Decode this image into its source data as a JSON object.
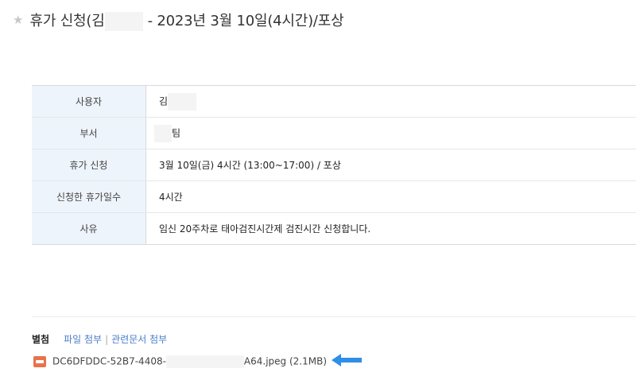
{
  "header": {
    "title_before": "휴가 신청(김",
    "title_after": "- 2023년 3월 10일(4시간)/포상"
  },
  "details": {
    "rows": [
      {
        "label": "사용자",
        "value": "김"
      },
      {
        "label": "부서",
        "value": "팀"
      },
      {
        "label": "휴가 신청",
        "value": "3월 10일(금) 4시간 (13:00~17:00) / 포상"
      },
      {
        "label": "신청한 휴가일수",
        "value": "4시간"
      },
      {
        "label": "사유",
        "value": "임신 20주차로 태아검진시간제 검진시간 신청합니다."
      }
    ]
  },
  "attachments": {
    "label": "별첨",
    "file_attach_link": "파일 첨부",
    "separator": "|",
    "related_doc_link": "관련문서 첨부",
    "file": {
      "name_start": "DC6DFDDC-52B7-4408-",
      "name_end": "A64.jpeg",
      "size": "(2.1MB)"
    }
  },
  "colors": {
    "label_bg": "#eef4fb",
    "link": "#4a7ec9",
    "arrow": "#2f8fe6",
    "file_icon": "#e8734a"
  },
  "icons": {
    "star": "star-icon",
    "file": "image-file-icon",
    "pointer": "arrow-left-icon"
  }
}
